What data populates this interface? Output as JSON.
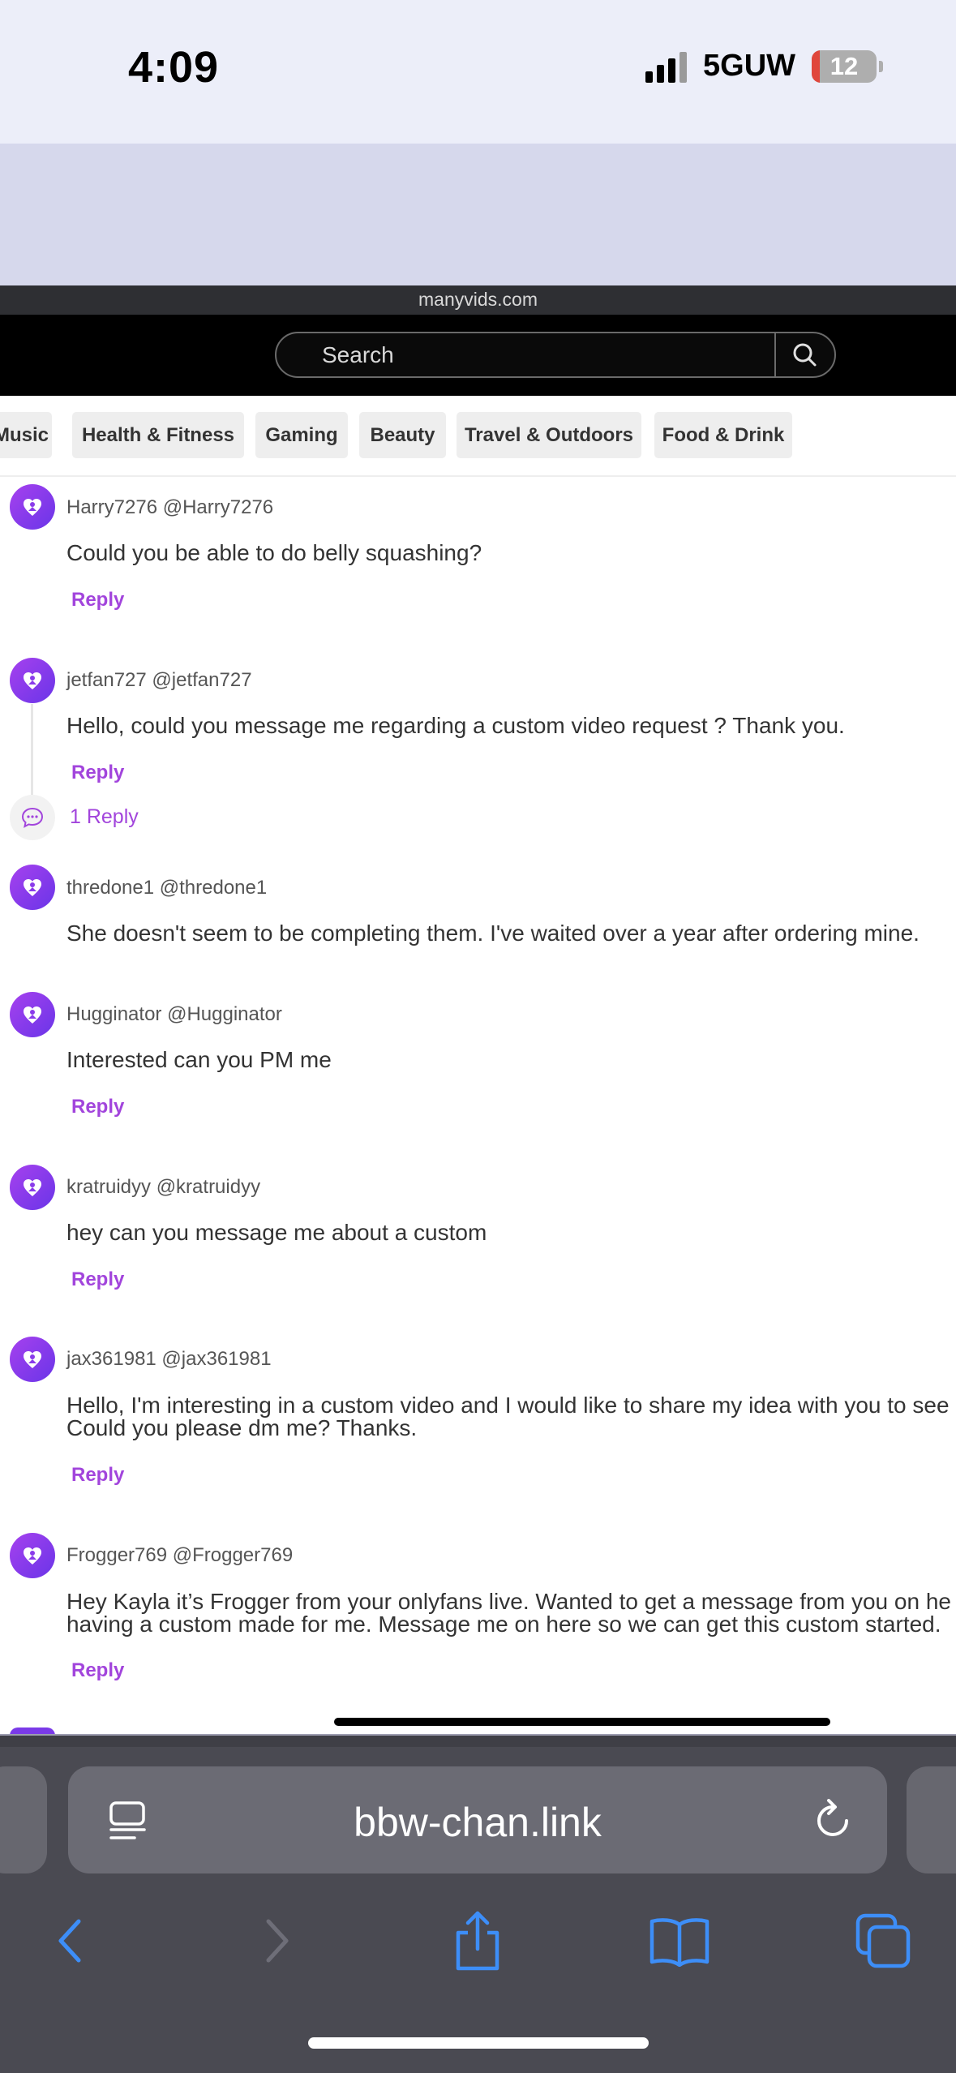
{
  "status_bar": {
    "time": "4:09",
    "network": "5GUW",
    "battery": "12"
  },
  "site": {
    "domain": "manyvids.com",
    "search_placeholder": "Search"
  },
  "categories": [
    "Music",
    "Health & Fitness",
    "Gaming",
    "Beauty",
    "Travel & Outdoors",
    "Food & Drink"
  ],
  "comments": [
    {
      "user": "Harry7276 @Harry7276",
      "text": [
        "Could you be able to do belly squashing?"
      ],
      "reply": "Reply"
    },
    {
      "user": "jetfan727 @jetfan727",
      "text": [
        "Hello, could you message me regarding a custom video request ? Thank you."
      ],
      "reply": "Reply",
      "replies": "1 Reply"
    },
    {
      "user": "thredone1 @thredone1",
      "text": [
        "She doesn't seem to be completing them. I've waited over a year after ordering mine."
      ]
    },
    {
      "user": "Hugginator @Hugginator",
      "text": [
        "Interested can you PM me"
      ],
      "reply": "Reply"
    },
    {
      "user": "kratruidyy @kratruidyy",
      "text": [
        "hey can you message me about a custom"
      ],
      "reply": "Reply"
    },
    {
      "user": "jax361981 @jax361981",
      "text": [
        "Hello, I'm interesting in a custom video and I would like to share my idea with you to see",
        "Could you please dm me? Thanks."
      ],
      "reply": "Reply"
    },
    {
      "user": "Frogger769 @Frogger769",
      "text": [
        "Hey Kayla it’s Frogger from your onlyfans live. Wanted to get a message from you on he",
        "having a custom made for me. Message me on here so we can get this custom started."
      ],
      "reply": "Reply"
    }
  ],
  "browser": {
    "url": "bbw-chan.link"
  },
  "icons": {
    "search": "search-icon",
    "avatar": "avatar-icon",
    "replies": "chat-bubble-icon",
    "reader": "reader-icon",
    "reload": "reload-icon",
    "back": "back-icon",
    "forward": "forward-icon",
    "share": "share-icon",
    "bookmarks": "bookmarks-icon",
    "tabs": "tabs-icon"
  },
  "colors": {
    "accent": "#a245dc",
    "safari_toolbar": "#4a4a52",
    "safari_accent": "#3d8ef8"
  }
}
